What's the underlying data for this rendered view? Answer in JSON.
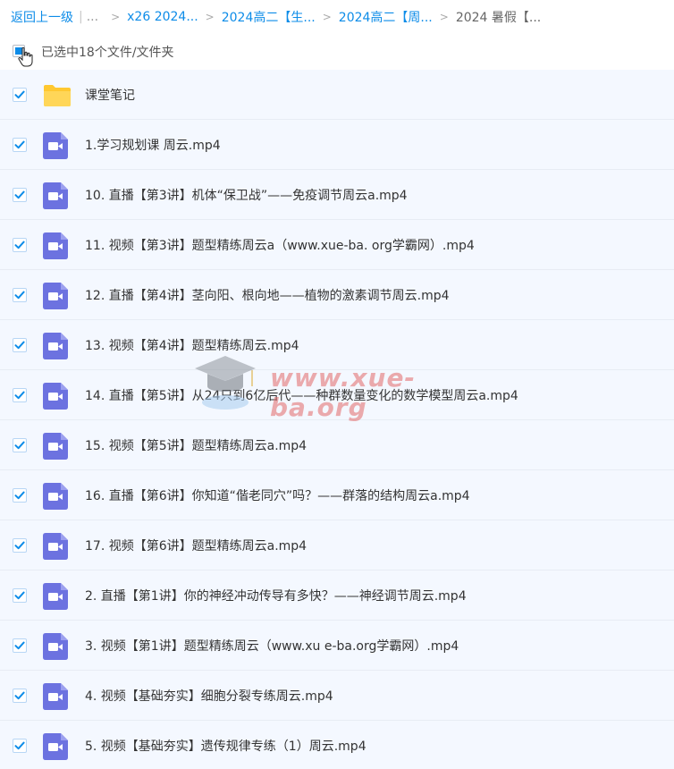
{
  "breadcrumb": {
    "back_label": "返回上一级",
    "pipe": "|",
    "ellipsis": "...",
    "items": [
      {
        "label": "x26 2024..."
      },
      {
        "label": "2024高二【生..."
      },
      {
        "label": "2024高二【周..."
      },
      {
        "label": "2024 暑假【..."
      }
    ]
  },
  "selection": {
    "summary": "已选中18个文件/文件夹"
  },
  "files": [
    {
      "name": "课堂笔记",
      "type": "folder"
    },
    {
      "name": "1.学习规划课 周云.mp4",
      "type": "video"
    },
    {
      "name": "10. 直播【第3讲】机体“保卫战”——免疫调节周云a.mp4",
      "type": "video"
    },
    {
      "name": "11. 视频【第3讲】题型精练周云a（www.xue-ba. org学霸网）.mp4",
      "type": "video"
    },
    {
      "name": "12. 直播【第4讲】茎向阳、根向地——植物的激素调节周云.mp4",
      "type": "video"
    },
    {
      "name": "13. 视频【第4讲】题型精练周云.mp4",
      "type": "video"
    },
    {
      "name": "14. 直播【第5讲】从24只到6亿后代——种群数量变化的数学模型周云a.mp4",
      "type": "video"
    },
    {
      "name": "15. 视频【第5讲】题型精练周云a.mp4",
      "type": "video"
    },
    {
      "name": "16. 直播【第6讲】你知道“偕老同穴”吗？——群落的结构周云a.mp4",
      "type": "video"
    },
    {
      "name": "17. 视频【第6讲】题型精练周云a.mp4",
      "type": "video"
    },
    {
      "name": "2. 直播【第1讲】你的神经冲动传导有多快？——神经调节周云.mp4",
      "type": "video"
    },
    {
      "name": "3. 视频【第1讲】题型精练周云（www.xu e-ba.org学霸网）.mp4",
      "type": "video"
    },
    {
      "name": "4. 视频【基础夯实】细胞分裂专练周云.mp4",
      "type": "video"
    },
    {
      "name": "5. 视频【基础夯实】遗传规律专练（1）周云.mp4",
      "type": "video"
    }
  ],
  "watermark": {
    "text": "www.xue-ba.org"
  },
  "icons": {
    "checkbox": "checkbox-checked-icon",
    "folder": "folder-icon",
    "video": "video-file-icon",
    "cursor": "hand-cursor-icon",
    "logo": "graduation-cap-icon"
  },
  "colors": {
    "accent": "#0d8ce8",
    "row_bg": "#f4f8ff",
    "video_icon": "#6c72e0",
    "folder_icon": "#ffc830",
    "watermark": "#e36a6a"
  }
}
